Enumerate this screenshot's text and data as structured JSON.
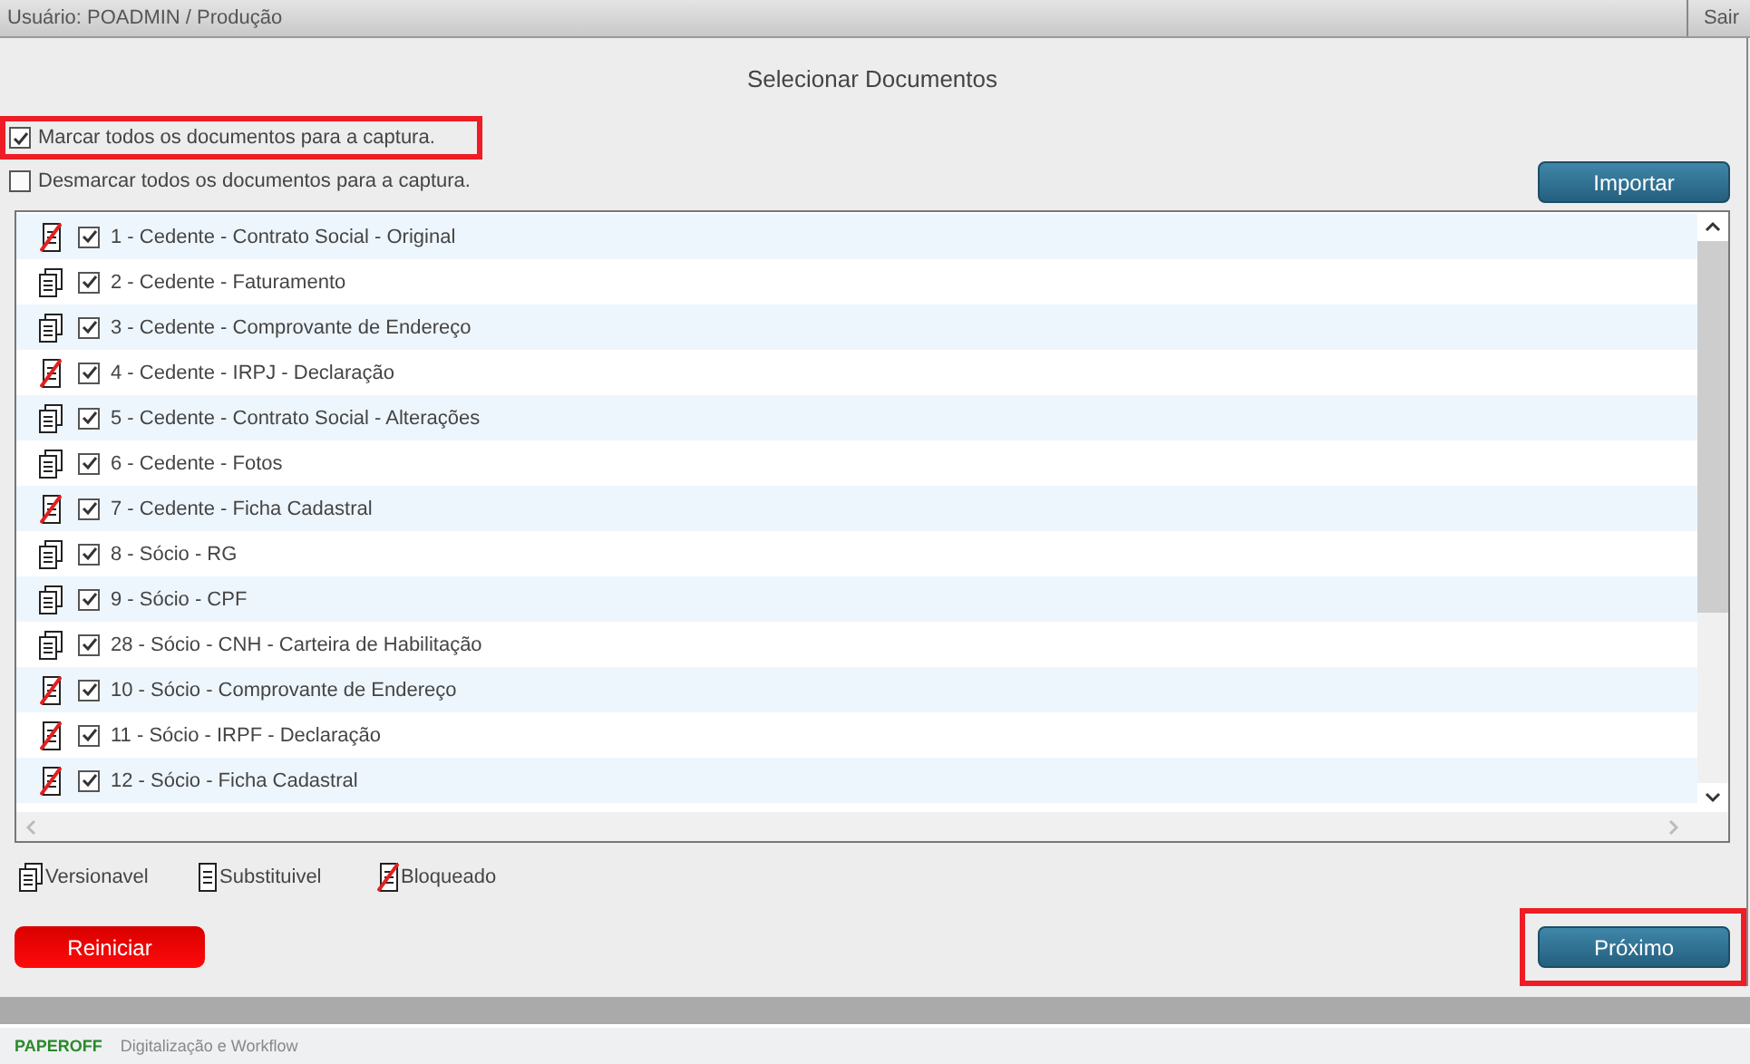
{
  "top_bar": {
    "user": "Usuário: POADMIN / Produção",
    "logout": "Sair"
  },
  "title": "Selecionar Documentos",
  "bulk_options": [
    {
      "label": "Marcar todos os documentos para a captura.",
      "checked": true,
      "highlighted": true
    },
    {
      "label": "Desmarcar todos os documentos para a captura.",
      "checked": false,
      "highlighted": false
    }
  ],
  "import_button": "Importar",
  "documents": [
    {
      "kind": "blocked",
      "checked": true,
      "label": "1 - Cedente - Contrato Social - Original"
    },
    {
      "kind": "versioned",
      "checked": true,
      "label": "2 - Cedente - Faturamento"
    },
    {
      "kind": "versioned",
      "checked": true,
      "label": "3 - Cedente - Comprovante de Endereço"
    },
    {
      "kind": "blocked",
      "checked": true,
      "label": "4 - Cedente - IRPJ - Declaração"
    },
    {
      "kind": "versioned",
      "checked": true,
      "label": "5 - Cedente - Contrato Social - Alterações"
    },
    {
      "kind": "versioned",
      "checked": true,
      "label": "6 - Cedente - Fotos"
    },
    {
      "kind": "blocked",
      "checked": true,
      "label": "7 - Cedente - Ficha Cadastral"
    },
    {
      "kind": "versioned",
      "checked": true,
      "label": "8 - Sócio - RG"
    },
    {
      "kind": "versioned",
      "checked": true,
      "label": "9 - Sócio - CPF"
    },
    {
      "kind": "versioned",
      "checked": true,
      "label": "28 - Sócio - CNH - Carteira de Habilitação"
    },
    {
      "kind": "blocked",
      "checked": true,
      "label": "10 - Sócio - Comprovante de Endereço"
    },
    {
      "kind": "blocked",
      "checked": true,
      "label": "11 - Sócio - IRPF - Declaração"
    },
    {
      "kind": "blocked",
      "checked": true,
      "label": "12 - Sócio - Ficha Cadastral"
    }
  ],
  "legend": [
    {
      "kind": "versioned",
      "label": "Versionavel"
    },
    {
      "kind": "replaceable",
      "label": "Substituivel"
    },
    {
      "kind": "blocked",
      "label": "Bloqueado"
    }
  ],
  "restart_button": "Reiniciar",
  "next_button": {
    "label": "Próximo",
    "highlighted": true
  },
  "footer": {
    "logo": "PAPEROFF",
    "tagline": "Digitalização e Workflow"
  }
}
